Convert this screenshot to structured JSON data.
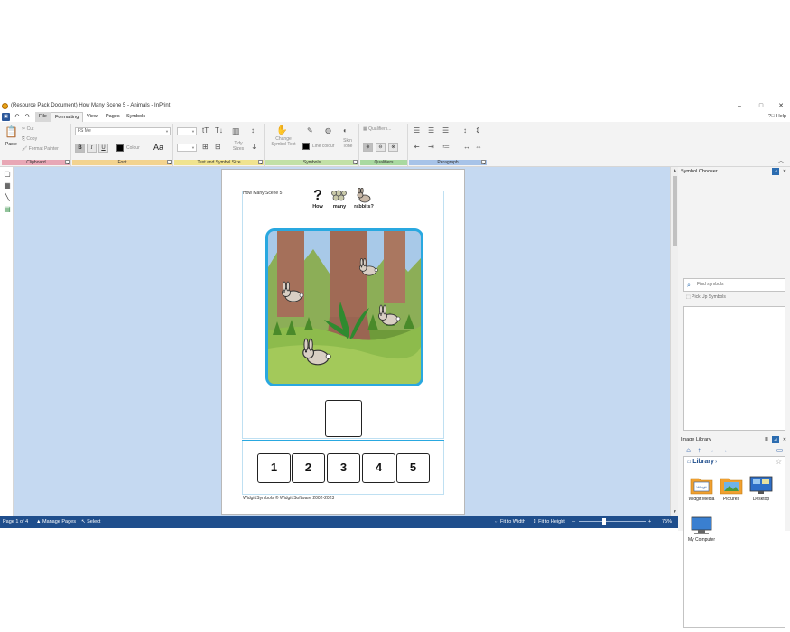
{
  "window": {
    "title": "(Resource Pack Document) How Many Scene 5 - Animals - InPrint",
    "minimize": "–",
    "maximize": "□",
    "close": "✕"
  },
  "menu": {
    "tabs": [
      "File",
      "Formatting",
      "View",
      "Pages",
      "Symbols"
    ],
    "active_tab": "Formatting",
    "help": "Help"
  },
  "ribbon": {
    "clipboard": {
      "paste": "Paste",
      "cut": "Cut",
      "copy": "Copy",
      "format_painter": "Format Painter",
      "label": "Clipboard"
    },
    "font": {
      "font_name": "FS Me",
      "bold": "B",
      "italic": "I",
      "underline": "U",
      "colour": "Colour",
      "case": "Aa",
      "label": "Font"
    },
    "text_size": {
      "tidy_sizes": "Tidy Sizes",
      "label": "Text and Symbol Size"
    },
    "symbols": {
      "change_symbol_text": "Change Symbol Text",
      "line_colour": "Line colour",
      "skin_tone": "Skin Tone",
      "label": "Symbols"
    },
    "qualifiers": {
      "qualifiers": "Qualifiers...",
      "label": "Qualifiers"
    },
    "paragraph": {
      "label": "Paragraph"
    }
  },
  "document": {
    "page_title": "How Many Scene 5",
    "question_words": [
      "How",
      "many",
      "rabbits?"
    ],
    "numbers": [
      "1",
      "2",
      "3",
      "4",
      "5"
    ],
    "copyright": "Widgit Symbols © Widgit Software 2002-2023",
    "rabbit_count": 4
  },
  "symbol_chooser": {
    "title": "Symbol Chooser",
    "search_placeholder": "Find symbols",
    "pick_up": "Pick Up Symbols"
  },
  "image_library": {
    "title": "Image Library",
    "breadcrumb": "Library",
    "items": [
      {
        "label": "Widgit Media",
        "icon": "folder-widgit-icon"
      },
      {
        "label": "Pictures",
        "icon": "folder-pictures-icon"
      },
      {
        "label": "Desktop",
        "icon": "desktop-icon"
      },
      {
        "label": "My Computer",
        "icon": "computer-icon"
      }
    ]
  },
  "status": {
    "page": "Page 1 of 4",
    "manage_pages": "Manage Pages",
    "select": "Select",
    "fit_width": "Fit to Width",
    "fit_height": "Fit to Height",
    "zoom_minus": "–",
    "zoom_plus": "+",
    "zoom": "75%",
    "zoom_fraction": 0.37
  },
  "colors": {
    "canvas": "#c5d9f1",
    "accent": "#1f4e8c",
    "scene_border": "#29a8e0",
    "group_clipboard": "#e8a7b5",
    "group_font": "#f3d38f",
    "group_size": "#f0e38f",
    "group_symbols": "#c2e0a6",
    "group_qualifiers": "#a9d9a0",
    "group_paragraph": "#a7c3e8"
  }
}
